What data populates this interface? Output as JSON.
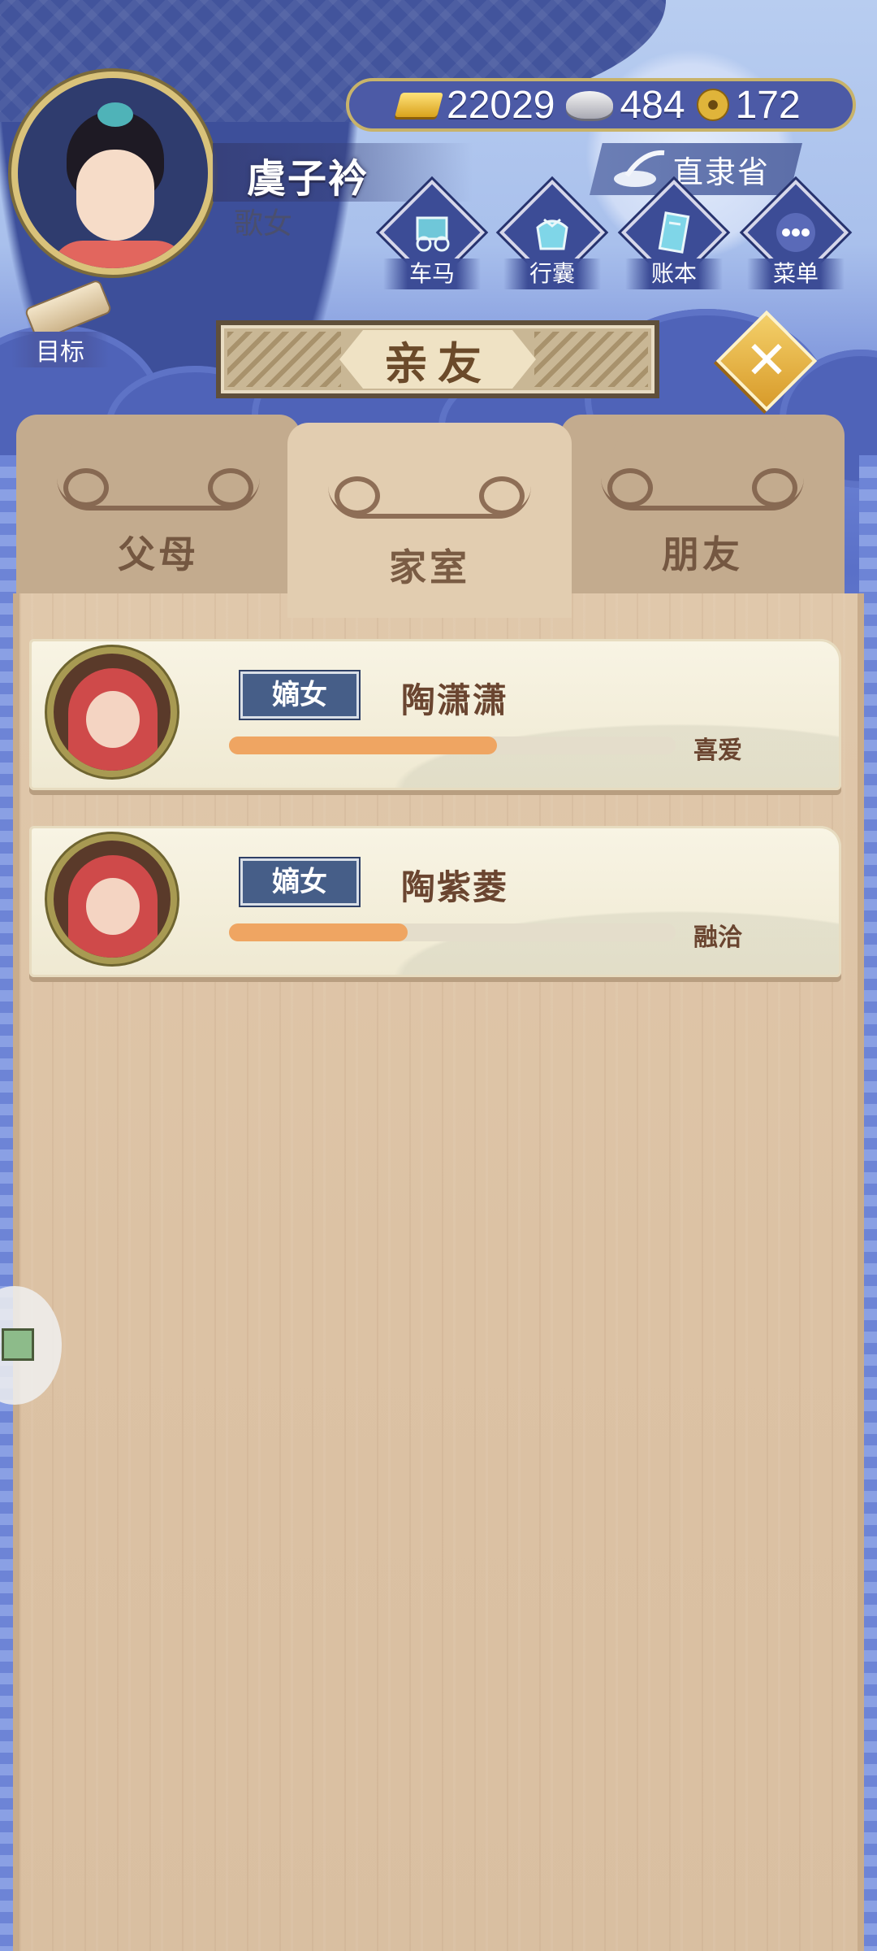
{
  "player": {
    "name": "虞子衿",
    "title": "歌女"
  },
  "resources": {
    "gold": "22029",
    "silver": "484",
    "coins": "172"
  },
  "location": "直隶省",
  "menu": [
    {
      "label": "车马",
      "icon": "carriage-icon"
    },
    {
      "label": "行囊",
      "icon": "bag-icon"
    },
    {
      "label": "账本",
      "icon": "ledger-icon"
    },
    {
      "label": "菜单",
      "icon": "more-icon"
    }
  ],
  "goal_label": "目标",
  "panel_title": "亲友",
  "tabs": [
    {
      "label": "父母",
      "active": false
    },
    {
      "label": "家室",
      "active": true
    },
    {
      "label": "朋友",
      "active": false
    }
  ],
  "members": [
    {
      "rank": "嫡女",
      "name": "陶潇潇",
      "relation": "喜爱",
      "affection": 0.6
    },
    {
      "rank": "嫡女",
      "name": "陶紫菱",
      "relation": "融洽",
      "affection": 0.4
    }
  ],
  "colors": {
    "accent": "#efa562",
    "banner_text": "#6b4a2a",
    "rank_tag": "#465e88"
  }
}
